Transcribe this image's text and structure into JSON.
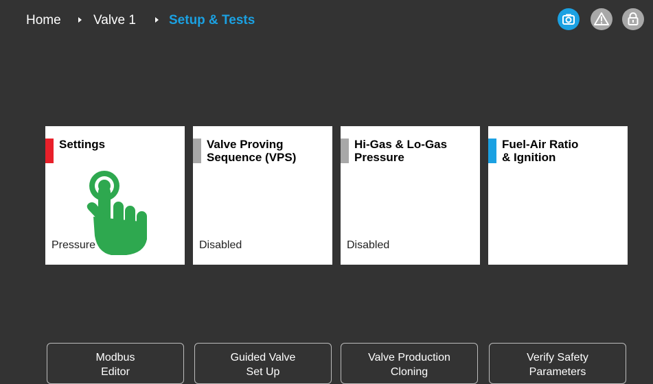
{
  "breadcrumb": {
    "items": [
      {
        "label": "Home"
      },
      {
        "label": "Valve 1"
      },
      {
        "label": "Setup & Tests"
      }
    ]
  },
  "header_icons": [
    {
      "icon": "camera-icon",
      "color": "#1ba1e2"
    },
    {
      "icon": "warning-icon",
      "color": "#a8a8a8"
    },
    {
      "icon": "lock-icon",
      "color": "#a8a8a8"
    }
  ],
  "tiles": [
    {
      "title_line1": "Settings",
      "title_line2": "",
      "status": "Pressure Module",
      "accent": "#e8202a"
    },
    {
      "title_line1": "Valve Proving",
      "title_line2": "Sequence (VPS)",
      "status": "Disabled",
      "accent": "#a8a8a8"
    },
    {
      "title_line1": "Hi-Gas & Lo-Gas",
      "title_line2": "Pressure",
      "status": "Disabled",
      "accent": "#a8a8a8"
    },
    {
      "title_line1": "Fuel-Air Ratio",
      "title_line2": "& Ignition",
      "status": "",
      "accent": "#1ba1e2"
    }
  ],
  "overlay": {
    "icon": "tap-hand-icon",
    "color": "#2ea84f"
  },
  "buttons": [
    {
      "line1": "Modbus",
      "line2": "Editor"
    },
    {
      "line1": "Guided Valve",
      "line2": "Set Up"
    },
    {
      "line1": "Valve Production",
      "line2": "Cloning"
    },
    {
      "line1": "Verify Safety",
      "line2": "Parameters"
    }
  ]
}
